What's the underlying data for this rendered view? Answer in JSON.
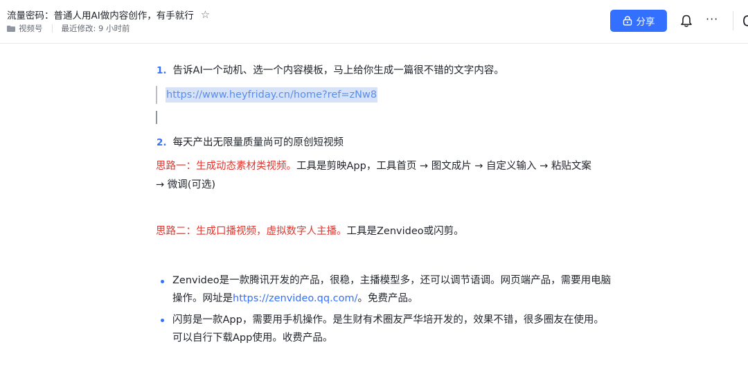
{
  "header": {
    "title": "流量密码：普通人用AI做内容创作，有手就行",
    "folder": "视频号",
    "last_modified": "最近修改: 9 小时前",
    "share_label": "分享",
    "more_label": "···",
    "accent": "#3370ff"
  },
  "content": {
    "step1": {
      "num": "1.",
      "text": "告诉AI一个动机、选一个内容模板，马上给你生成一篇很不错的文字内容。",
      "link": "https://www.heyfriday.cn/home?ref=zNw8"
    },
    "step2": {
      "num": "2.",
      "text": "每天产出无限量质量尚可的原创短视频"
    },
    "idea1": {
      "label": "思路一：生成动态素材类视频。",
      "text1": "工具是剪映App，工具首页 → 图文成片 → 自定义输入 → 粘贴文案",
      "text2": "→ 微调(可选)"
    },
    "idea2": {
      "label": "思路二：生成口播视频，虚拟数字人主播。",
      "text": "工具是Zenvideo或闪剪。"
    },
    "bullets": [
      {
        "line1": "Zenvideo是一款腾讯开发的产品，很稳，主播模型多，还可以调节语调。网页端产品，需要用电脑",
        "line2_pre": "操作。网址是",
        "line2_link": "https://zenvideo.qq.com/",
        "line2_post": "。免费产品。"
      },
      {
        "line1": "闪剪是一款App，需要用手机操作。是生财有术圈友严华培开发的，效果不错，很多圈友在使用。",
        "line2": "可以自行下载App使用。收费产品。"
      }
    ],
    "red_color": "#e0362e"
  }
}
